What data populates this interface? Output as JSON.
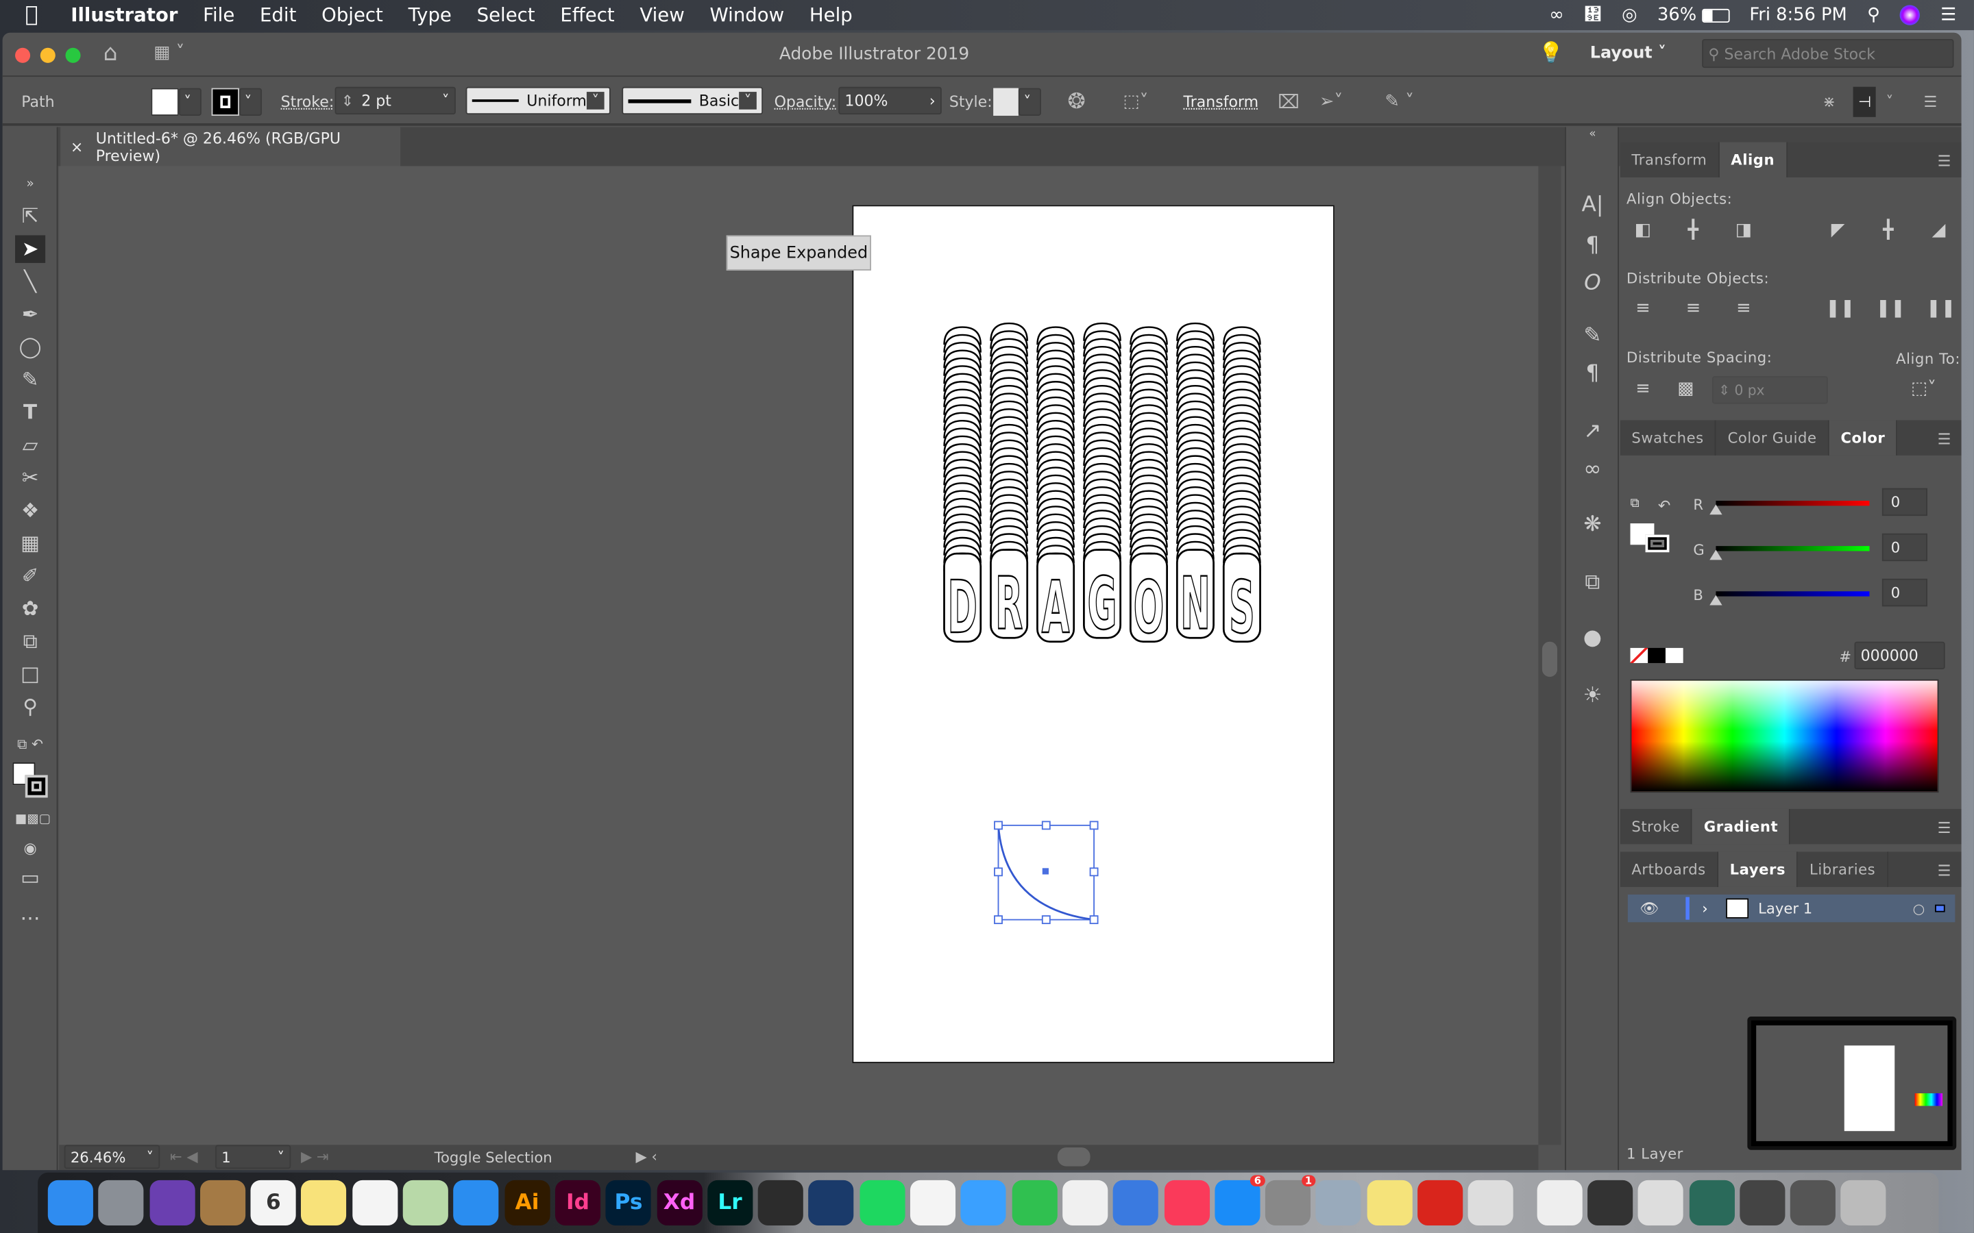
{
  "menubar": {
    "apple": "",
    "app": "Illustrator",
    "items": [
      "File",
      "Edit",
      "Object",
      "Type",
      "Select",
      "Effect",
      "View",
      "Window",
      "Help"
    ],
    "battery": "36%",
    "clock": "Fri 8:56 PM"
  },
  "titlebar": {
    "title": "Adobe Illustrator 2019",
    "workspace": "Layout",
    "search_placeholder": "Search Adobe Stock"
  },
  "control": {
    "selection": "Path",
    "stroke_label": "Stroke:",
    "stroke_value": "2 pt",
    "profile": "Uniform",
    "brush": "Basic",
    "opacity_label": "Opacity:",
    "opacity_value": "100%",
    "style_label": "Style:",
    "transform": "Transform"
  },
  "document": {
    "tab": "Untitled-6* @ 26.46% (RGB/GPU Preview)",
    "close": "×"
  },
  "canvas": {
    "tooltip": "Shape Expanded",
    "artwork_text": "DRAGONS"
  },
  "align": {
    "tabs": [
      "Transform",
      "Align"
    ],
    "align_objects": "Align Objects:",
    "distribute_objects": "Distribute Objects:",
    "distribute_spacing": "Distribute Spacing:",
    "align_to": "Align To:",
    "spacing_placeholder": "0 px"
  },
  "color": {
    "tabs": [
      "Swatches",
      "Color Guide",
      "Color"
    ],
    "channels": [
      {
        "label": "R",
        "value": "0",
        "color": "#ff0000"
      },
      {
        "label": "G",
        "value": "0",
        "color": "#00ff00"
      },
      {
        "label": "B",
        "value": "0",
        "color": "#0000ff"
      }
    ],
    "hash": "#",
    "hex": "000000"
  },
  "stroke_gradient": {
    "tabs": [
      "Stroke",
      "Gradient"
    ]
  },
  "layers": {
    "tabs": [
      "Artboards",
      "Layers",
      "Libraries"
    ],
    "layer_name": "Layer 1",
    "count": "1 Layer",
    "layer_color": "#4f7cff"
  },
  "status": {
    "zoom": "26.46%",
    "artboard": "1",
    "toggle": "Toggle Selection"
  },
  "dock": [
    {
      "name": "finder",
      "label": "",
      "bg": "#2f8cf0"
    },
    {
      "name": "launchpad",
      "label": "",
      "bg": "#8a8f96"
    },
    {
      "name": "siri",
      "label": "",
      "bg": "#6a3fb0"
    },
    {
      "name": "contacts",
      "label": "",
      "bg": "#a47a45"
    },
    {
      "name": "calendar",
      "label": "6",
      "bg": "#f4f4f4"
    },
    {
      "name": "notes",
      "label": "",
      "bg": "#f8e27a"
    },
    {
      "name": "reminders",
      "label": "",
      "bg": "#f4f4f4"
    },
    {
      "name": "maps",
      "label": "",
      "bg": "#b8d9a8"
    },
    {
      "name": "safari",
      "label": "",
      "bg": "#2a8df0"
    },
    {
      "name": "illustrator",
      "label": "Ai",
      "bg": "#2f1a00",
      "fg": "#ff9a00"
    },
    {
      "name": "indesign",
      "label": "Id",
      "bg": "#3a0020",
      "fg": "#ff3f8f"
    },
    {
      "name": "photoshop",
      "label": "Ps",
      "bg": "#001d34",
      "fg": "#31a8ff"
    },
    {
      "name": "xd",
      "label": "Xd",
      "bg": "#2e001f",
      "fg": "#ff61f6"
    },
    {
      "name": "lightroom",
      "label": "Lr",
      "bg": "#001a1a",
      "fg": "#31fbfb"
    },
    {
      "name": "figma",
      "label": "",
      "bg": "#2c2c2c"
    },
    {
      "name": "kindle",
      "label": "",
      "bg": "#1a3a6a"
    },
    {
      "name": "spotify",
      "label": "",
      "bg": "#1ed760"
    },
    {
      "name": "photos",
      "label": "",
      "bg": "#f4f4f4"
    },
    {
      "name": "messages",
      "label": "",
      "bg": "#3aa0ff"
    },
    {
      "name": "facetime",
      "label": "",
      "bg": "#30c050"
    },
    {
      "name": "textedit",
      "label": "",
      "bg": "#f0f0f0"
    },
    {
      "name": "keynote",
      "label": "",
      "bg": "#3a7ae0"
    },
    {
      "name": "music",
      "label": "",
      "bg": "#fa3a5a"
    },
    {
      "name": "app-store",
      "label": "",
      "bg": "#1a8cf8",
      "badge": "6"
    },
    {
      "name": "system-preferences",
      "label": "",
      "bg": "#888",
      "badge": "1"
    },
    {
      "name": "preview",
      "label": "",
      "bg": "#9ab"
    },
    {
      "name": "stickies",
      "label": "",
      "bg": "#f5e37a"
    },
    {
      "name": "creative-cloud",
      "label": "",
      "bg": "#d9251c"
    },
    {
      "name": "printer",
      "label": "",
      "bg": "#ddd"
    },
    {
      "name": "screenshot-1",
      "label": "",
      "bg": "#eee"
    },
    {
      "name": "screenshot-2",
      "label": "",
      "bg": "#333"
    },
    {
      "name": "screenshot-3",
      "label": "",
      "bg": "#ddd"
    },
    {
      "name": "screenshot-4",
      "label": "",
      "bg": "#2a6a5a"
    },
    {
      "name": "screenshot-5",
      "label": "",
      "bg": "#444"
    },
    {
      "name": "screenshot-6",
      "label": "",
      "bg": "#555"
    },
    {
      "name": "trash",
      "label": "",
      "bg": "#bbb"
    }
  ]
}
